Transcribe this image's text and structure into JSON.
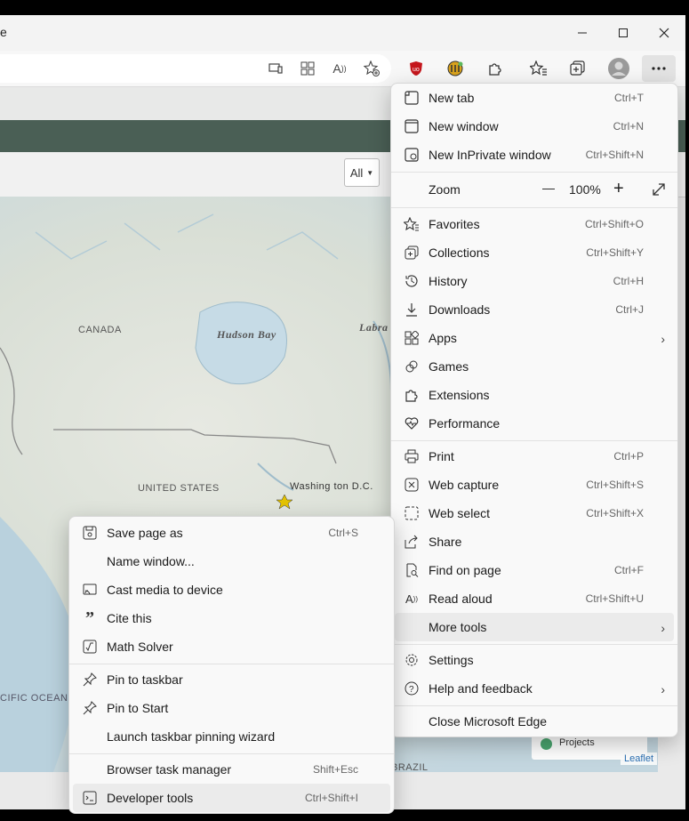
{
  "window": {
    "title_fragment": "e"
  },
  "page": {
    "filter_select": "All",
    "map_labels": {
      "canada": "CANADA",
      "hudson_bay": "Hudson Bay",
      "labrador": "Labra",
      "united_states": "UNITED STATES",
      "washington": "Washing ton D.C.",
      "pacific": "CIFIC OCEAN",
      "brazil": "BRAZIL"
    },
    "legend_item": "Projects",
    "attribution": "Leaflet"
  },
  "main_menu": {
    "new_tab": {
      "label": "New tab",
      "shortcut": "Ctrl+T"
    },
    "new_window": {
      "label": "New window",
      "shortcut": "Ctrl+N"
    },
    "new_inprivate": {
      "label": "New InPrivate window",
      "shortcut": "Ctrl+Shift+N"
    },
    "zoom": {
      "label": "Zoom",
      "value": "100%",
      "minus": "—",
      "plus": "+"
    },
    "favorites": {
      "label": "Favorites",
      "shortcut": "Ctrl+Shift+O"
    },
    "collections": {
      "label": "Collections",
      "shortcut": "Ctrl+Shift+Y"
    },
    "history": {
      "label": "History",
      "shortcut": "Ctrl+H"
    },
    "downloads": {
      "label": "Downloads",
      "shortcut": "Ctrl+J"
    },
    "apps": {
      "label": "Apps"
    },
    "games": {
      "label": "Games"
    },
    "extensions": {
      "label": "Extensions"
    },
    "performance": {
      "label": "Performance"
    },
    "print": {
      "label": "Print",
      "shortcut": "Ctrl+P"
    },
    "web_capture": {
      "label": "Web capture",
      "shortcut": "Ctrl+Shift+S"
    },
    "web_select": {
      "label": "Web select",
      "shortcut": "Ctrl+Shift+X"
    },
    "share": {
      "label": "Share"
    },
    "find_on_page": {
      "label": "Find on page",
      "shortcut": "Ctrl+F"
    },
    "read_aloud": {
      "label": "Read aloud",
      "shortcut": "Ctrl+Shift+U"
    },
    "more_tools": {
      "label": "More tools"
    },
    "settings": {
      "label": "Settings"
    },
    "help_feedback": {
      "label": "Help and feedback"
    },
    "close_edge": {
      "label": "Close Microsoft Edge"
    }
  },
  "sub_menu": {
    "save_page_as": {
      "label": "Save page as",
      "shortcut": "Ctrl+S"
    },
    "name_window": {
      "label": "Name window..."
    },
    "cast_media": {
      "label": "Cast media to device"
    },
    "cite_this": {
      "label": "Cite this"
    },
    "math_solver": {
      "label": "Math Solver"
    },
    "pin_taskbar": {
      "label": "Pin to taskbar"
    },
    "pin_start": {
      "label": "Pin to Start"
    },
    "pinning_wizard": {
      "label": "Launch taskbar pinning wizard"
    },
    "task_manager": {
      "label": "Browser task manager",
      "shortcut": "Shift+Esc"
    },
    "developer_tools": {
      "label": "Developer tools",
      "shortcut": "Ctrl+Shift+I"
    }
  },
  "colors": {
    "accent_green": "#4a5f55",
    "ublock_red": "#c4161c",
    "menu_bg": "#f9f9f9",
    "legend_dot": "#4aa56f"
  }
}
